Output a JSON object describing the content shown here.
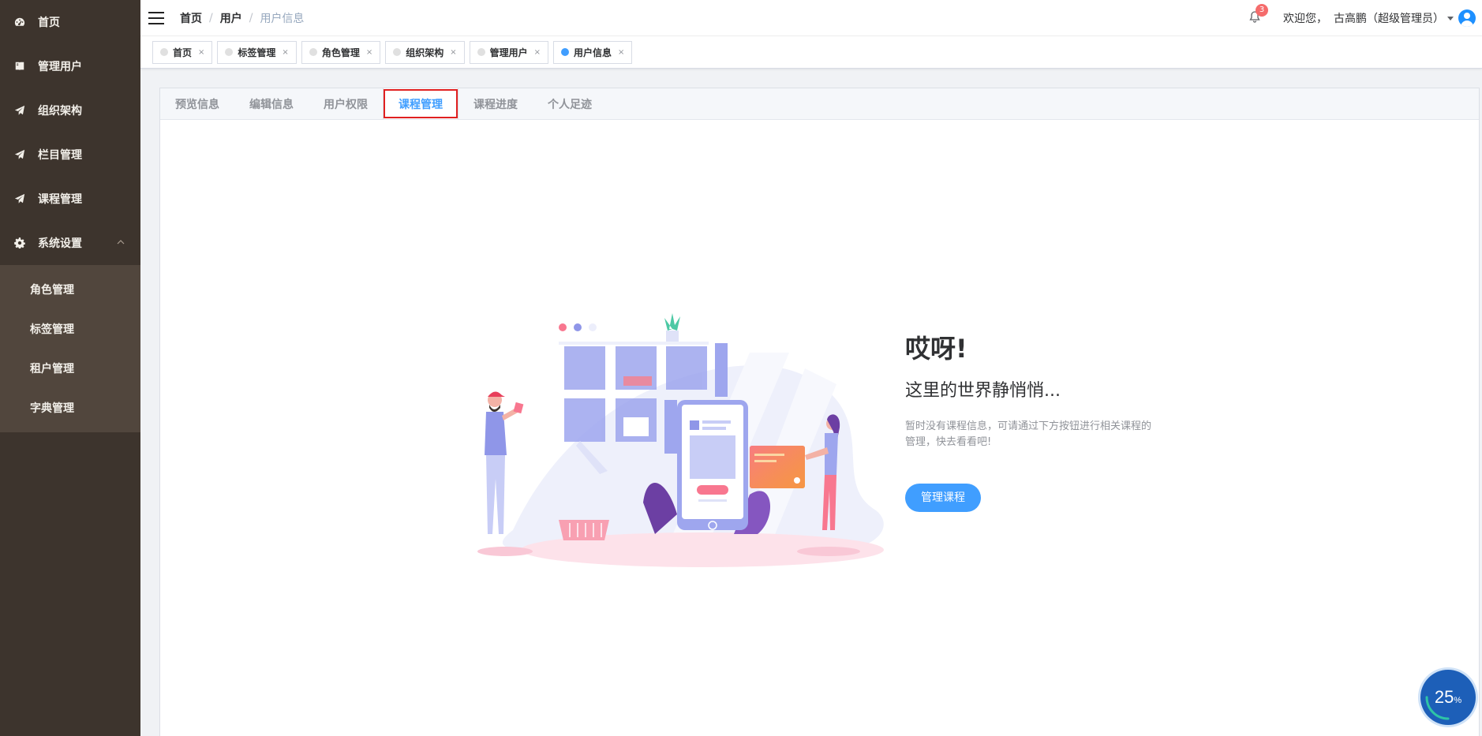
{
  "sidebar": {
    "items": [
      {
        "label": "首页",
        "icon": "dashboard-icon"
      },
      {
        "label": "管理用户",
        "icon": "book-icon"
      },
      {
        "label": "组织架构",
        "icon": "paper-plane-icon"
      },
      {
        "label": "栏目管理",
        "icon": "paper-plane-icon"
      },
      {
        "label": "课程管理",
        "icon": "paper-plane-icon"
      },
      {
        "label": "系统设置",
        "icon": "gear-icon",
        "expanded": true
      }
    ],
    "submenu": [
      "角色管理",
      "标签管理",
      "租户管理",
      "字典管理"
    ]
  },
  "header": {
    "breadcrumb": [
      "首页",
      "用户",
      "用户信息"
    ],
    "notification_count": "3",
    "welcome": "欢迎您，",
    "username": "古高鹏（超级管理员）"
  },
  "tags": [
    {
      "label": "首页",
      "active": false
    },
    {
      "label": "标签管理",
      "active": false
    },
    {
      "label": "角色管理",
      "active": false
    },
    {
      "label": "组织架构",
      "active": false
    },
    {
      "label": "管理用户",
      "active": false
    },
    {
      "label": "用户信息",
      "active": true
    }
  ],
  "tabs": [
    {
      "label": "预览信息"
    },
    {
      "label": "编辑信息"
    },
    {
      "label": "用户权限"
    },
    {
      "label": "课程管理",
      "active": true
    },
    {
      "label": "课程进度"
    },
    {
      "label": "个人足迹"
    }
  ],
  "empty": {
    "title": "哎呀!",
    "subtitle": "这里的世界静悄悄...",
    "description": "暂时没有课程信息，可请通过下方按钮进行相关课程的管理，快去看看吧!",
    "button": "管理课程"
  },
  "progress": {
    "value": "25",
    "unit": "%"
  },
  "colors": {
    "sidebar_bg": "#3d342d",
    "accent": "#409eff",
    "highlight_border": "#e02020",
    "badge": "#f56c6c"
  }
}
